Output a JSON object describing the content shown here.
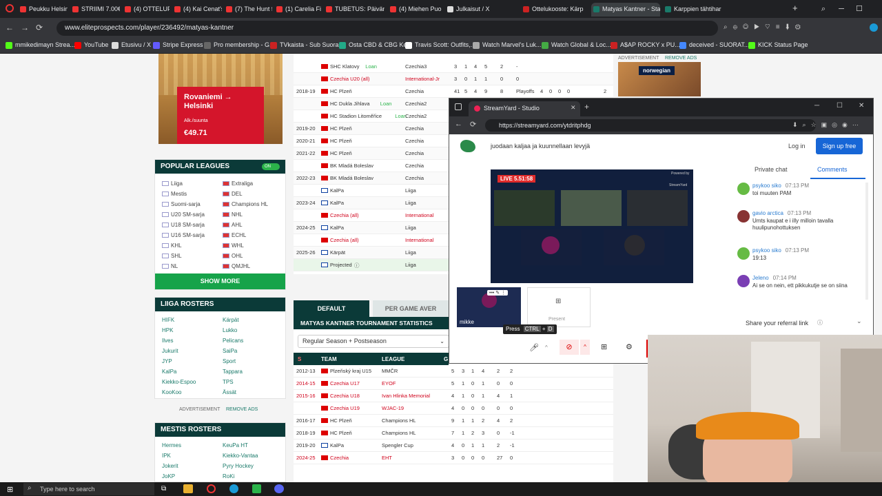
{
  "browser": {
    "tabs": [
      {
        "label": "Peukku Helsingin",
        "color": "#e33"
      },
      {
        "label": "STRIIMI 7.00€ VAIN",
        "color": "#e33"
      },
      {
        "label": "(4) OTTELUPÄIVÄ K",
        "color": "#e33"
      },
      {
        "label": "(4) Kai Cenat's Frie",
        "color": "#e33"
      },
      {
        "label": "(7) The Hunt for th",
        "color": "#e33"
      },
      {
        "label": "(1) Carelia Fight X",
        "color": "#e33"
      },
      {
        "label": "TUBETUS: Päivän p",
        "color": "#e33"
      },
      {
        "label": "(4) Miehen Puolikk",
        "color": "#e33"
      },
      {
        "label": "Julkaisut / X",
        "color": "#ddd"
      },
      {
        "label": "Ottelukooste: Kärp",
        "color": "#c22"
      },
      {
        "label": "Matyas Kantner - Stats, C",
        "color": "#1a7a6a"
      },
      {
        "label": "Karppien tähtihar",
        "color": "#1a7a6a"
      }
    ],
    "url": "www.eliteprospects.com/player/236492/matyas-kantner",
    "bookmarks": [
      {
        "label": "mmikedimayn Strea...",
        "color": "#53fc18"
      },
      {
        "label": "YouTube",
        "color": "#f00"
      },
      {
        "label": "Etusivu / X",
        "color": "#ddd"
      },
      {
        "label": "Stripe Express",
        "color": "#635bff"
      },
      {
        "label": "Pro membership - G...",
        "color": "#666"
      },
      {
        "label": "TVkaista - Sub Suora",
        "color": "#c22"
      },
      {
        "label": "Osta CBD & CBG Ke...",
        "color": "#2a8"
      },
      {
        "label": "Travis Scott: Outfits,...",
        "color": "#fff"
      },
      {
        "label": "Watch Marvel's Luk...",
        "color": "#aaa"
      },
      {
        "label": "Watch Global & Loc...",
        "color": "#4a4"
      },
      {
        "label": "A$AP ROCKY x PU...",
        "color": "#c22"
      },
      {
        "label": "deceived - SUORAT...",
        "color": "#48f"
      },
      {
        "label": "KICK Status Page",
        "color": "#53fc18"
      }
    ]
  },
  "ad": {
    "title": "Rovaniemi → Helsinki",
    "subtitle": "Alk./suunta",
    "price": "€49.71",
    "right_label": "ADVERTISEMENT",
    "remove_ads": "REMOVE ADS",
    "right_brand": "norwegian"
  },
  "popular_leagues": {
    "title": "POPULAR LEAGUES",
    "toggle": "ON",
    "col1": [
      "Liiga",
      "Mestis",
      "Suomi-sarja",
      "U20 SM-sarja",
      "U18 SM-sarja",
      "U16 SM-sarja",
      "KHL",
      "SHL",
      "NL"
    ],
    "col2": [
      "Extraliga",
      "DEL",
      "Champions HL",
      "NHL",
      "AHL",
      "ECHL",
      "WHL",
      "OHL",
      "QMJHL"
    ],
    "show_more": "SHOW MORE"
  },
  "liiga_rosters": {
    "title": "LIIGA ROSTERS",
    "col1": [
      "HIFK",
      "HPK",
      "Ilves",
      "Jukurit",
      "JYP",
      "KalPa",
      "Kiekko-Espoo",
      "KooKoo"
    ],
    "col2": [
      "Kärpät",
      "Lukko",
      "Pelicans",
      "SaiPa",
      "Sport",
      "Tappara",
      "TPS",
      "Ässät"
    ],
    "advert": "ADVERTISEMENT",
    "remove_ads": "REMOVE ADS"
  },
  "mestis_rosters": {
    "title": "MESTIS ROSTERS",
    "col1": [
      "Hermes",
      "IPK",
      "Jokerit",
      "JoKP"
    ],
    "col2": [
      "KeuPa HT",
      "Kiekko-Vantaa",
      "Pyry Hockey",
      "RoKi"
    ]
  },
  "career_rows": [
    {
      "season": "",
      "team": "SHC Klatovy",
      "tag": "Loan",
      "league": "Czechia3",
      "stats": [
        "3",
        "1",
        "4",
        "5",
        "2",
        "-"
      ],
      "red": false
    },
    {
      "season": "",
      "team": "Czechia U20 (all)",
      "tag": "",
      "league": "International-Jr",
      "stats": [
        "3",
        "0",
        "1",
        "1",
        "0",
        "0"
      ],
      "red": true
    },
    {
      "season": "2018-19",
      "team": "HC Plzeň",
      "tag": "",
      "league": "Czechia",
      "stats": [
        "41",
        "5",
        "4",
        "9",
        "8",
        "Playoffs"
      ],
      "red": false
    },
    {
      "season": "",
      "team": "HC Dukla Jihlava",
      "tag": "Loan",
      "league": "Czechia2",
      "stats": [
        "",
        "",
        "",
        "",
        "",
        ""
      ],
      "red": false
    },
    {
      "season": "",
      "team": "HC Stadion Litoměřice",
      "tag": "Loan",
      "league": "Czechia2",
      "stats": [
        "",
        "",
        "",
        "",
        "",
        ""
      ],
      "red": false
    },
    {
      "season": "2019-20",
      "team": "HC Plzeň",
      "tag": "",
      "league": "Czechia",
      "stats": [
        "",
        "",
        "",
        "",
        "",
        ""
      ],
      "red": false
    },
    {
      "season": "2020-21",
      "team": "HC Plzeň",
      "tag": "",
      "league": "Czechia",
      "stats": [
        "",
        "",
        "",
        "",
        "",
        ""
      ],
      "red": false
    },
    {
      "season": "2021-22",
      "team": "HC Plzeň",
      "tag": "",
      "league": "Czechia",
      "stats": [
        "",
        "",
        "",
        "",
        "",
        ""
      ],
      "red": false
    },
    {
      "season": "",
      "team": "BK Mladá Boleslav",
      "tag": "",
      "league": "Czechia",
      "stats": [
        "",
        "",
        "",
        "",
        "",
        ""
      ],
      "red": false
    },
    {
      "season": "2022-23",
      "team": "BK Mladá Boleslav",
      "tag": "",
      "league": "Czechia",
      "stats": [
        "",
        "",
        "",
        "",
        "",
        ""
      ],
      "red": false
    },
    {
      "season": "",
      "team": "KalPa",
      "tag": "",
      "league": "Liiga",
      "stats": [
        "",
        "",
        "",
        "",
        "",
        ""
      ],
      "red": false
    },
    {
      "season": "2023-24",
      "team": "KalPa",
      "tag": "",
      "league": "Liiga",
      "stats": [
        "",
        "",
        "",
        "",
        "",
        ""
      ],
      "red": false
    },
    {
      "season": "",
      "team": "Czechia (all)",
      "tag": "",
      "league": "International",
      "stats": [
        "",
        "",
        "",
        "",
        "",
        ""
      ],
      "red": true
    },
    {
      "season": "2024-25",
      "team": "KalPa",
      "tag": "",
      "league": "Liiga",
      "stats": [
        "",
        "",
        "",
        "",
        "",
        ""
      ],
      "red": false
    },
    {
      "season": "",
      "team": "Czechia (all)",
      "tag": "",
      "league": "International",
      "stats": [
        "",
        "",
        "",
        "",
        "",
        ""
      ],
      "red": true
    },
    {
      "season": "2025-26",
      "team": "Kärpät",
      "tag": "",
      "league": "Liiga",
      "stats": [
        "",
        "",
        "",
        "",
        "",
        ""
      ],
      "red": false
    },
    {
      "season": "",
      "team": "Projected",
      "tag": "",
      "league": "Liiga",
      "stats": [
        "",
        "",
        "",
        "",
        "",
        ""
      ],
      "red": false
    }
  ],
  "playoff_extra": [
    "4",
    "0",
    "0",
    "0",
    "2"
  ],
  "tournament": {
    "tab_default": "DEFAULT",
    "tab_avg": "PER GAME AVER",
    "title": "MATYAS KANTNER TOURNAMENT STATISTICS",
    "select": "Regular Season + Postseason",
    "col_s": "S",
    "col_team": "TEAM",
    "col_league": "LEAGUE",
    "col_g": "G",
    "rows": [
      {
        "season": "2012-13",
        "team": "Plzeňský kraj U15",
        "league": "MMČR",
        "stats": [
          "5",
          "3",
          "1",
          "4",
          "2",
          "2"
        ],
        "red": false
      },
      {
        "season": "2014-15",
        "team": "Czechia U17",
        "league": "EYOF",
        "stats": [
          "5",
          "1",
          "0",
          "1",
          "0",
          "0"
        ],
        "red": true
      },
      {
        "season": "2015-16",
        "team": "Czechia U18",
        "league": "Ivan Hlinka Memorial",
        "stats": [
          "4",
          "1",
          "0",
          "1",
          "4",
          "1"
        ],
        "red": true
      },
      {
        "season": "",
        "team": "Czechia U19",
        "league": "WJAC-19",
        "stats": [
          "4",
          "0",
          "0",
          "0",
          "0",
          "0"
        ],
        "red": true
      },
      {
        "season": "2016-17",
        "team": "HC Plzeň",
        "league": "Champions HL",
        "stats": [
          "9",
          "1",
          "1",
          "2",
          "4",
          "2"
        ],
        "red": false
      },
      {
        "season": "2018-19",
        "team": "HC Plzeň",
        "league": "Champions HL",
        "stats": [
          "7",
          "1",
          "2",
          "3",
          "0",
          "-1"
        ],
        "red": false
      },
      {
        "season": "2019-20",
        "team": "KalPa",
        "league": "Spengler Cup",
        "stats": [
          "4",
          "0",
          "1",
          "1",
          "2",
          "-1"
        ],
        "red": false
      },
      {
        "season": "2024-25",
        "team": "Czechia",
        "league": "EHT",
        "stats": [
          "3",
          "0",
          "0",
          "0",
          "27",
          "0"
        ],
        "red": true
      }
    ]
  },
  "streamyard": {
    "tab_title": "StreamYard - Studio",
    "url": "https://streamyard.com/ytdritphdg",
    "headline": "juodaan kaljaa ja kuunnellaan levyjä",
    "login": "Log in",
    "signup": "Sign up free",
    "live_badge": "LIVE 5.51:58",
    "powered": "Powered by",
    "brand": "StreamYard",
    "tile_name": "mikke",
    "present": "Present",
    "press": "Press",
    "ctrl": "CTRL",
    "plus": "+",
    "key_d": "D",
    "tab_private": "Private chat",
    "tab_comments": "Comments",
    "comments": [
      {
        "name": "psykoo siko",
        "time": "07:13 PM",
        "text": "toi muuten PAM",
        "color": "#6b4"
      },
      {
        "name": "gavio arctica",
        "time": "07:13 PM",
        "text": "Umts kaupat e i illy milloin tavalla huulipunohottuksen",
        "color": "#833"
      },
      {
        "name": "psykoo siko",
        "time": "07:13 PM",
        "text": "19:13",
        "color": "#6b4"
      },
      {
        "name": "Jeleno",
        "time": "07:14 PM",
        "text": "Ai se on nein, ett pikkukutje se on siina",
        "color": "#7a3fb4"
      }
    ],
    "referral": "Share your referral link"
  },
  "taskbar": {
    "search_placeholder": "Type here to search"
  }
}
